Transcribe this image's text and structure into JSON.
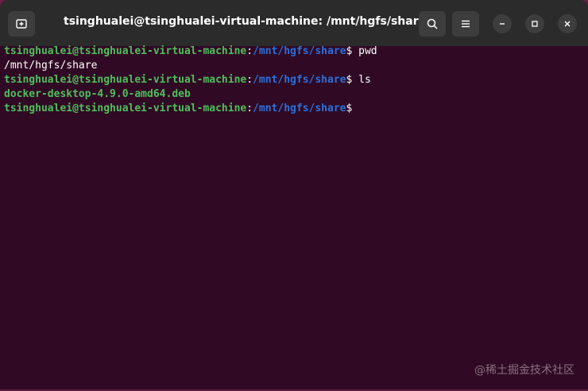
{
  "window": {
    "title": "tsinghualei@tsinghualei-virtual-machine: /mnt/hgfs/share"
  },
  "titlebar": {
    "new_tab_icon": "new-tab-icon",
    "search_icon": "search-icon",
    "menu_icon": "hamburger-menu-icon",
    "minimize_icon": "minimize-icon",
    "maximize_icon": "maximize-icon",
    "close_icon": "close-icon"
  },
  "terminal": {
    "lines": [
      {
        "user": "tsinghualei@tsinghualei-virtual-machine",
        "sep": ":",
        "path": "/mnt/hgfs/share",
        "prompt": "$ ",
        "command": "pwd"
      },
      {
        "output": "/mnt/hgfs/share"
      },
      {
        "user": "tsinghualei@tsinghualei-virtual-machine",
        "sep": ":",
        "path": "/mnt/hgfs/share",
        "prompt": "$ ",
        "command": "ls"
      },
      {
        "file": "docker-desktop-4.9.0-amd64.deb"
      },
      {
        "user": "tsinghualei@tsinghualei-virtual-machine",
        "sep": ":",
        "path": "/mnt/hgfs/share",
        "prompt": "$",
        "command": ""
      }
    ]
  },
  "watermark": "@稀土掘金技术社区",
  "colors": {
    "terminal_bg": "#300a24",
    "user_green": "#4ebf5b",
    "path_blue": "#2a6fdc",
    "titlebar_bg": "#2b2b2b"
  }
}
